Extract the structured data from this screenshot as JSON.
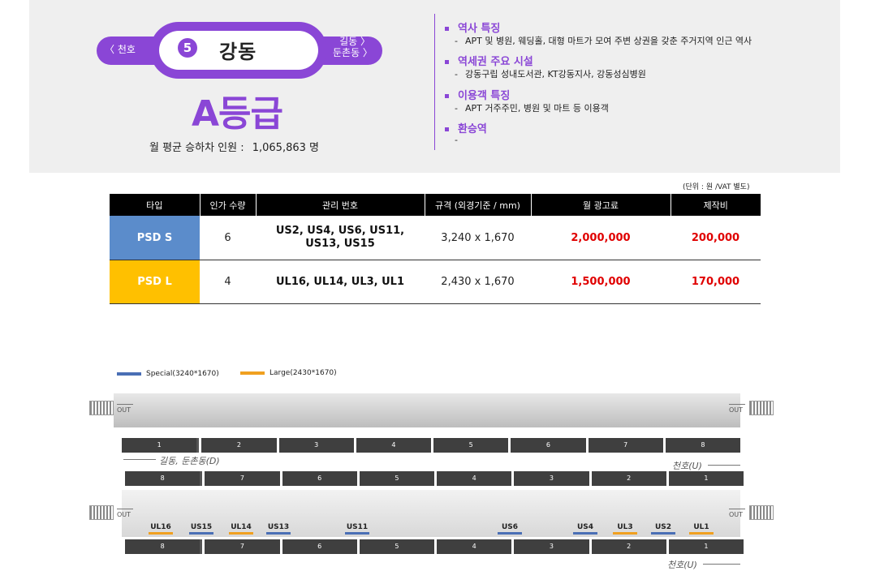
{
  "station": {
    "prev": "〈 천호",
    "next_line1": "길동 〉",
    "next_line2": "둔촌동 〉",
    "line_number": "5",
    "name": "강동",
    "grade": "A등급",
    "ridership_label": "월 평균 승하차 인원 :",
    "ridership_value": "1,065,863 명",
    "color": "#8a46d6"
  },
  "features": [
    {
      "title": "역사 특징",
      "desc": "APT 및 병원, 웨딩홀, 대형 마트가 모여 주변 상권을 갖춘 주거지역 인근 역사"
    },
    {
      "title": "역세권 주요 시설",
      "desc": "강동구립 성내도서관, KT강동지사, 강동성심병원"
    },
    {
      "title": "이용객 특징",
      "desc": "APT 거주주민, 병원 및 마트 등 이용객"
    },
    {
      "title": "환승역",
      "desc": ""
    }
  ],
  "table": {
    "unit_note": "(단위 : 원 /VAT 별도)",
    "headers": [
      "타입",
      "인가 수량",
      "관리 번호",
      "규격 (외경기준 / mm)",
      "월 광고료",
      "제작비"
    ],
    "rows": [
      {
        "type": "PSD S",
        "qty": "6",
        "ids_line1": "US2, US4, US6, US11,",
        "ids_line2": "US13, US15",
        "size": "3,240 x 1,670",
        "monthly": "2,000,000",
        "production": "200,000"
      },
      {
        "type": "PSD L",
        "qty": "4",
        "ids_line1": "UL16, UL14, UL3, UL1",
        "ids_line2": "",
        "size": "2,430 x 1,670",
        "monthly": "1,500,000",
        "production": "170,000"
      }
    ],
    "colors": {
      "psd_s": "#5b8ccb",
      "psd_l": "#ffc000",
      "price": "#e00000"
    }
  },
  "legend": [
    {
      "label": "Special(3240*1670)",
      "color": "#4a6fb5"
    },
    {
      "label": "Large(2430*1670)",
      "color": "#f0a020"
    }
  ],
  "diagram": {
    "out_label": "OUT",
    "top_cars": [
      "1",
      "2",
      "3",
      "4",
      "5",
      "6",
      "7",
      "8"
    ],
    "mid_cars": [
      "8",
      "7",
      "6",
      "5",
      "4",
      "3",
      "2",
      "1"
    ],
    "bottom_cars": [
      "8",
      "7",
      "6",
      "5",
      "4",
      "3",
      "2",
      "1"
    ],
    "dir_down": "길동, 둔촌동(D)",
    "dir_up_1": "천호(U)",
    "dir_up_2": "천호(U)",
    "ad_marks": [
      {
        "id": "UL16",
        "kind": "large"
      },
      {
        "id": "US15",
        "kind": "special"
      },
      {
        "id": "UL14",
        "kind": "large"
      },
      {
        "id": "US13",
        "kind": "special"
      },
      {
        "id": "US11",
        "kind": "special"
      },
      {
        "id": "US6",
        "kind": "special"
      },
      {
        "id": "US4",
        "kind": "special"
      },
      {
        "id": "UL3",
        "kind": "large"
      },
      {
        "id": "US2",
        "kind": "special"
      },
      {
        "id": "UL1",
        "kind": "large"
      }
    ]
  }
}
